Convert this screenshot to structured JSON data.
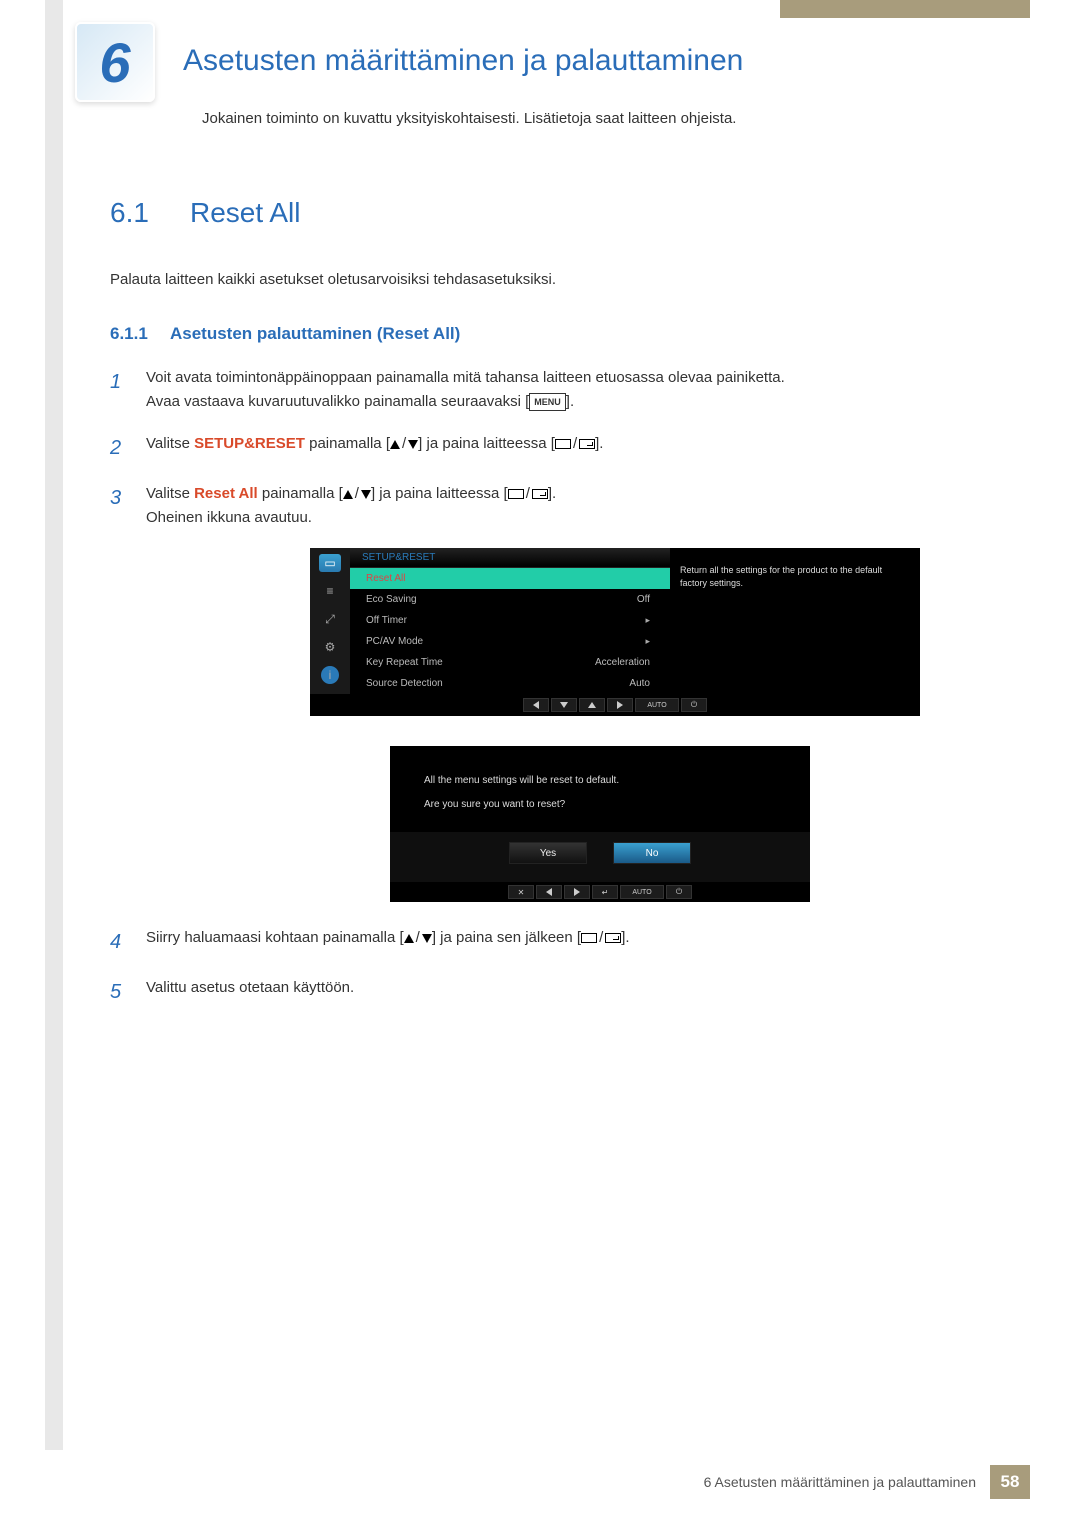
{
  "chapter": {
    "num": "6",
    "title": "Asetusten määrittäminen ja palauttaminen",
    "subtitle": "Jokainen toiminto on kuvattu yksityiskohtaisesti. Lisätietoja saat laitteen ohjeista."
  },
  "sec": {
    "num": "6.1",
    "title": "Reset All",
    "desc": "Palauta laitteen kaikki asetukset oletusarvoisiksi tehdasasetuksiksi."
  },
  "subsec": {
    "num": "6.1.1",
    "title": "Asetusten palauttaminen (Reset All)"
  },
  "steps": {
    "1a": "Voit avata toimintonäppäinoppaan painamalla mitä tahansa laitteen etuosassa olevaa painiketta.",
    "1b": "Avaa vastaava kuvaruutuvalikko painamalla seuraavaksi [",
    "1c": "].",
    "2a": "Valitse ",
    "2kw": "SETUP&RESET",
    "2b": " painamalla [",
    "2c": "] ja paina laitteessa [",
    "2d": "].",
    "3a": "Valitse ",
    "3kw": "Reset All",
    "3b": " painamalla [",
    "3c": "] ja paina laitteessa [",
    "3d": "].",
    "3e": "Oheinen ikkuna avautuu.",
    "4a": "Siirry haluamaasi kohtaan painamalla [",
    "4b": "] ja paina sen jälkeen [",
    "4c": "].",
    "5": "Valittu asetus otetaan käyttöön."
  },
  "menu_label": "MENU",
  "osd": {
    "header": "SETUP&RESET",
    "items": [
      {
        "label": "Reset All",
        "value": ""
      },
      {
        "label": "Eco Saving",
        "value": "Off"
      },
      {
        "label": "Off Timer",
        "value": "▸"
      },
      {
        "label": "PC/AV Mode",
        "value": "▸"
      },
      {
        "label": "Key Repeat Time",
        "value": "Acceleration"
      },
      {
        "label": "Source Detection",
        "value": "Auto"
      }
    ],
    "info": "Return all the settings for the product to the default factory settings.",
    "nav": {
      "auto": "AUTO"
    }
  },
  "confirm": {
    "line1": "All the menu settings will be reset to default.",
    "line2": "Are you sure you want to reset?",
    "yes": "Yes",
    "no": "No",
    "auto": "AUTO"
  },
  "footer": {
    "text": "6 Asetusten määrittäminen ja palauttaminen",
    "page": "58"
  }
}
